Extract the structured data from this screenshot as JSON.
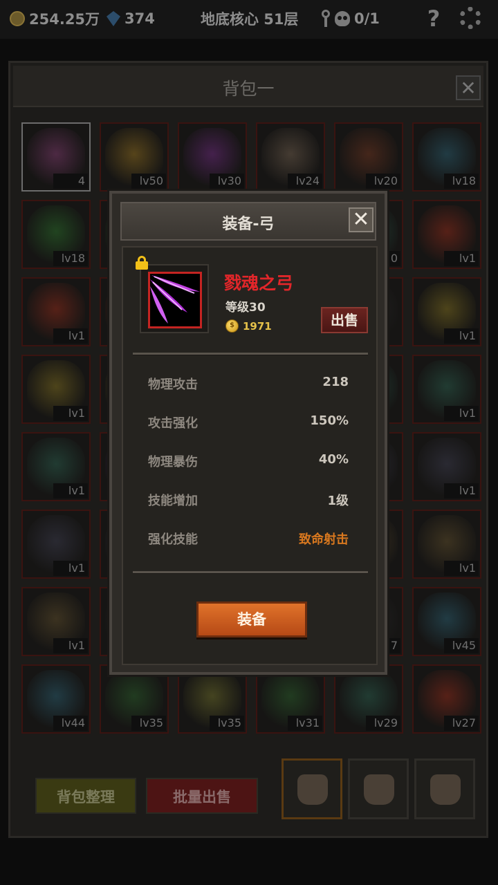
{
  "status_bar": {
    "coins": "254.25万",
    "gems": "374",
    "location": "地底核心 51层",
    "keys": "0/1",
    "help": "?"
  },
  "bag": {
    "title": "背包一",
    "close": "✕",
    "slots": [
      {
        "lv": "4",
        "color": "#7a3a6a"
      },
      {
        "lv": "lv50",
        "color": "#8a6a20"
      },
      {
        "lv": "lv30",
        "color": "#6a2a7a"
      },
      {
        "lv": "lv24",
        "color": "#6a5a4a"
      },
      {
        "lv": "lv20",
        "color": "#6a3420"
      },
      {
        "lv": "lv18",
        "color": "#2a5a6a"
      },
      {
        "lv": "lv18",
        "color": "#2a6a2a"
      },
      {
        "lv": "",
        "color": "#2a6a2a"
      },
      {
        "lv": "",
        "color": "#2a2a2a"
      },
      {
        "lv": "",
        "color": "#2a2a2a"
      },
      {
        "lv": "0",
        "color": "#2a5a4a"
      },
      {
        "lv": "lv1",
        "color": "#8a2a1a"
      },
      {
        "lv": "lv1",
        "color": "#8a2a1a"
      },
      {
        "lv": "",
        "color": "#8a2a1a"
      },
      {
        "lv": "",
        "color": "#2a2a2a"
      },
      {
        "lv": "",
        "color": "#2a2a2a"
      },
      {
        "lv": "",
        "color": "#2a2a2a"
      },
      {
        "lv": "lv1",
        "color": "#7a6a20"
      },
      {
        "lv": "lv1",
        "color": "#7a6a20"
      },
      {
        "lv": "",
        "color": "#7a6a20"
      },
      {
        "lv": "",
        "color": "#2a2a2a"
      },
      {
        "lv": "",
        "color": "#2a2a2a"
      },
      {
        "lv": "",
        "color": "#2a5a4a"
      },
      {
        "lv": "lv1",
        "color": "#2a5a4a"
      },
      {
        "lv": "lv1",
        "color": "#2a5a4a"
      },
      {
        "lv": "",
        "color": "#4a2a6a"
      },
      {
        "lv": "",
        "color": "#2a2a2a"
      },
      {
        "lv": "",
        "color": "#2a2a2a"
      },
      {
        "lv": "",
        "color": "#3a3a4a"
      },
      {
        "lv": "lv1",
        "color": "#3a3a4a"
      },
      {
        "lv": "lv1",
        "color": "#3a3a4a"
      },
      {
        "lv": "",
        "color": "#3a3a4a"
      },
      {
        "lv": "",
        "color": "#2a2a2a"
      },
      {
        "lv": "",
        "color": "#2a2a2a"
      },
      {
        "lv": "",
        "color": "#5a4a2a"
      },
      {
        "lv": "lv1",
        "color": "#5a4a2a"
      },
      {
        "lv": "lv1",
        "color": "#5a4a2a"
      },
      {
        "lv": "",
        "color": "#2a2a2a"
      },
      {
        "lv": "",
        "color": "#2a2a2a"
      },
      {
        "lv": "",
        "color": "#2a2a2a"
      },
      {
        "lv": "7",
        "color": "#2a2a2a"
      },
      {
        "lv": "lv45",
        "color": "#2a5a6a"
      },
      {
        "lv": "lv44",
        "color": "#2a5a6a"
      },
      {
        "lv": "lv35",
        "color": "#2a5a2a"
      },
      {
        "lv": "lv35",
        "color": "#6a6a2a"
      },
      {
        "lv": "lv31",
        "color": "#2a5a2a"
      },
      {
        "lv": "lv29",
        "color": "#2a5a4a"
      },
      {
        "lv": "lv27",
        "color": "#8a2a1a"
      }
    ],
    "sort_button": "背包整理",
    "bulk_sell_button": "批量出售"
  },
  "modal": {
    "title": "装备-弓",
    "close": "✕",
    "item_name": "戮魂之弓",
    "item_level": "等级30",
    "price": "1971",
    "coin_symbol": "$",
    "sell_button": "出售",
    "stats": [
      {
        "label": "物理攻击",
        "value": "218"
      },
      {
        "label": "攻击强化",
        "value": "150%"
      },
      {
        "label": "物理暴伤",
        "value": "40%"
      },
      {
        "label": "技能增加",
        "value": "1级"
      },
      {
        "label": "强化技能",
        "value": "致命射击"
      }
    ],
    "equip_button": "装备"
  }
}
